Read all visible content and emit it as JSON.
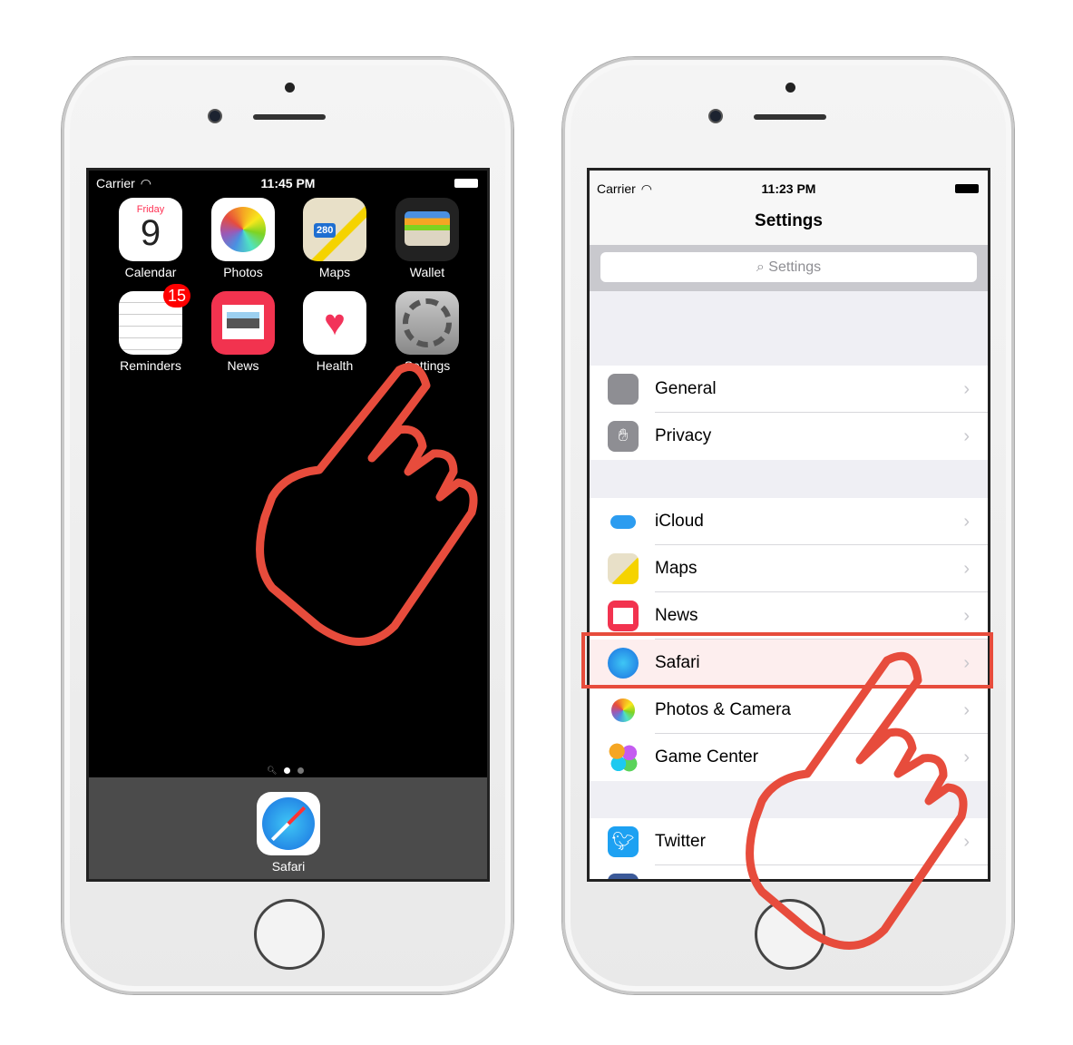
{
  "left_phone": {
    "status": {
      "carrier": "Carrier",
      "time": "11:45 PM"
    },
    "calendar_day": "Friday",
    "calendar_date": "9",
    "apps": [
      {
        "label": "Calendar",
        "icon": "calendar-icon"
      },
      {
        "label": "Photos",
        "icon": "photos-icon"
      },
      {
        "label": "Maps",
        "icon": "maps-icon"
      },
      {
        "label": "Wallet",
        "icon": "wallet-icon"
      },
      {
        "label": "Reminders",
        "icon": "reminders-icon",
        "badge": "15"
      },
      {
        "label": "News",
        "icon": "news-icon"
      },
      {
        "label": "Health",
        "icon": "health-icon"
      },
      {
        "label": "Settings",
        "icon": "settings-icon"
      }
    ],
    "maps_shield": "280",
    "dock": [
      {
        "label": "Safari",
        "icon": "safari-icon"
      }
    ]
  },
  "right_phone": {
    "status": {
      "carrier": "Carrier",
      "time": "11:23 PM"
    },
    "title": "Settings",
    "search_placeholder": "Settings",
    "rows": [
      {
        "label": "General"
      },
      {
        "label": "Privacy"
      },
      {
        "label": "iCloud"
      },
      {
        "label": "Maps"
      },
      {
        "label": "News"
      },
      {
        "label": "Safari",
        "highlighted": true
      },
      {
        "label": "Photos & Camera"
      },
      {
        "label": "Game Center"
      },
      {
        "label": "Twitter"
      }
    ]
  },
  "colors": {
    "annotation": "#e74c3c",
    "ios_blue": "#1a8cf0",
    "group_bg": "#efeff4"
  }
}
